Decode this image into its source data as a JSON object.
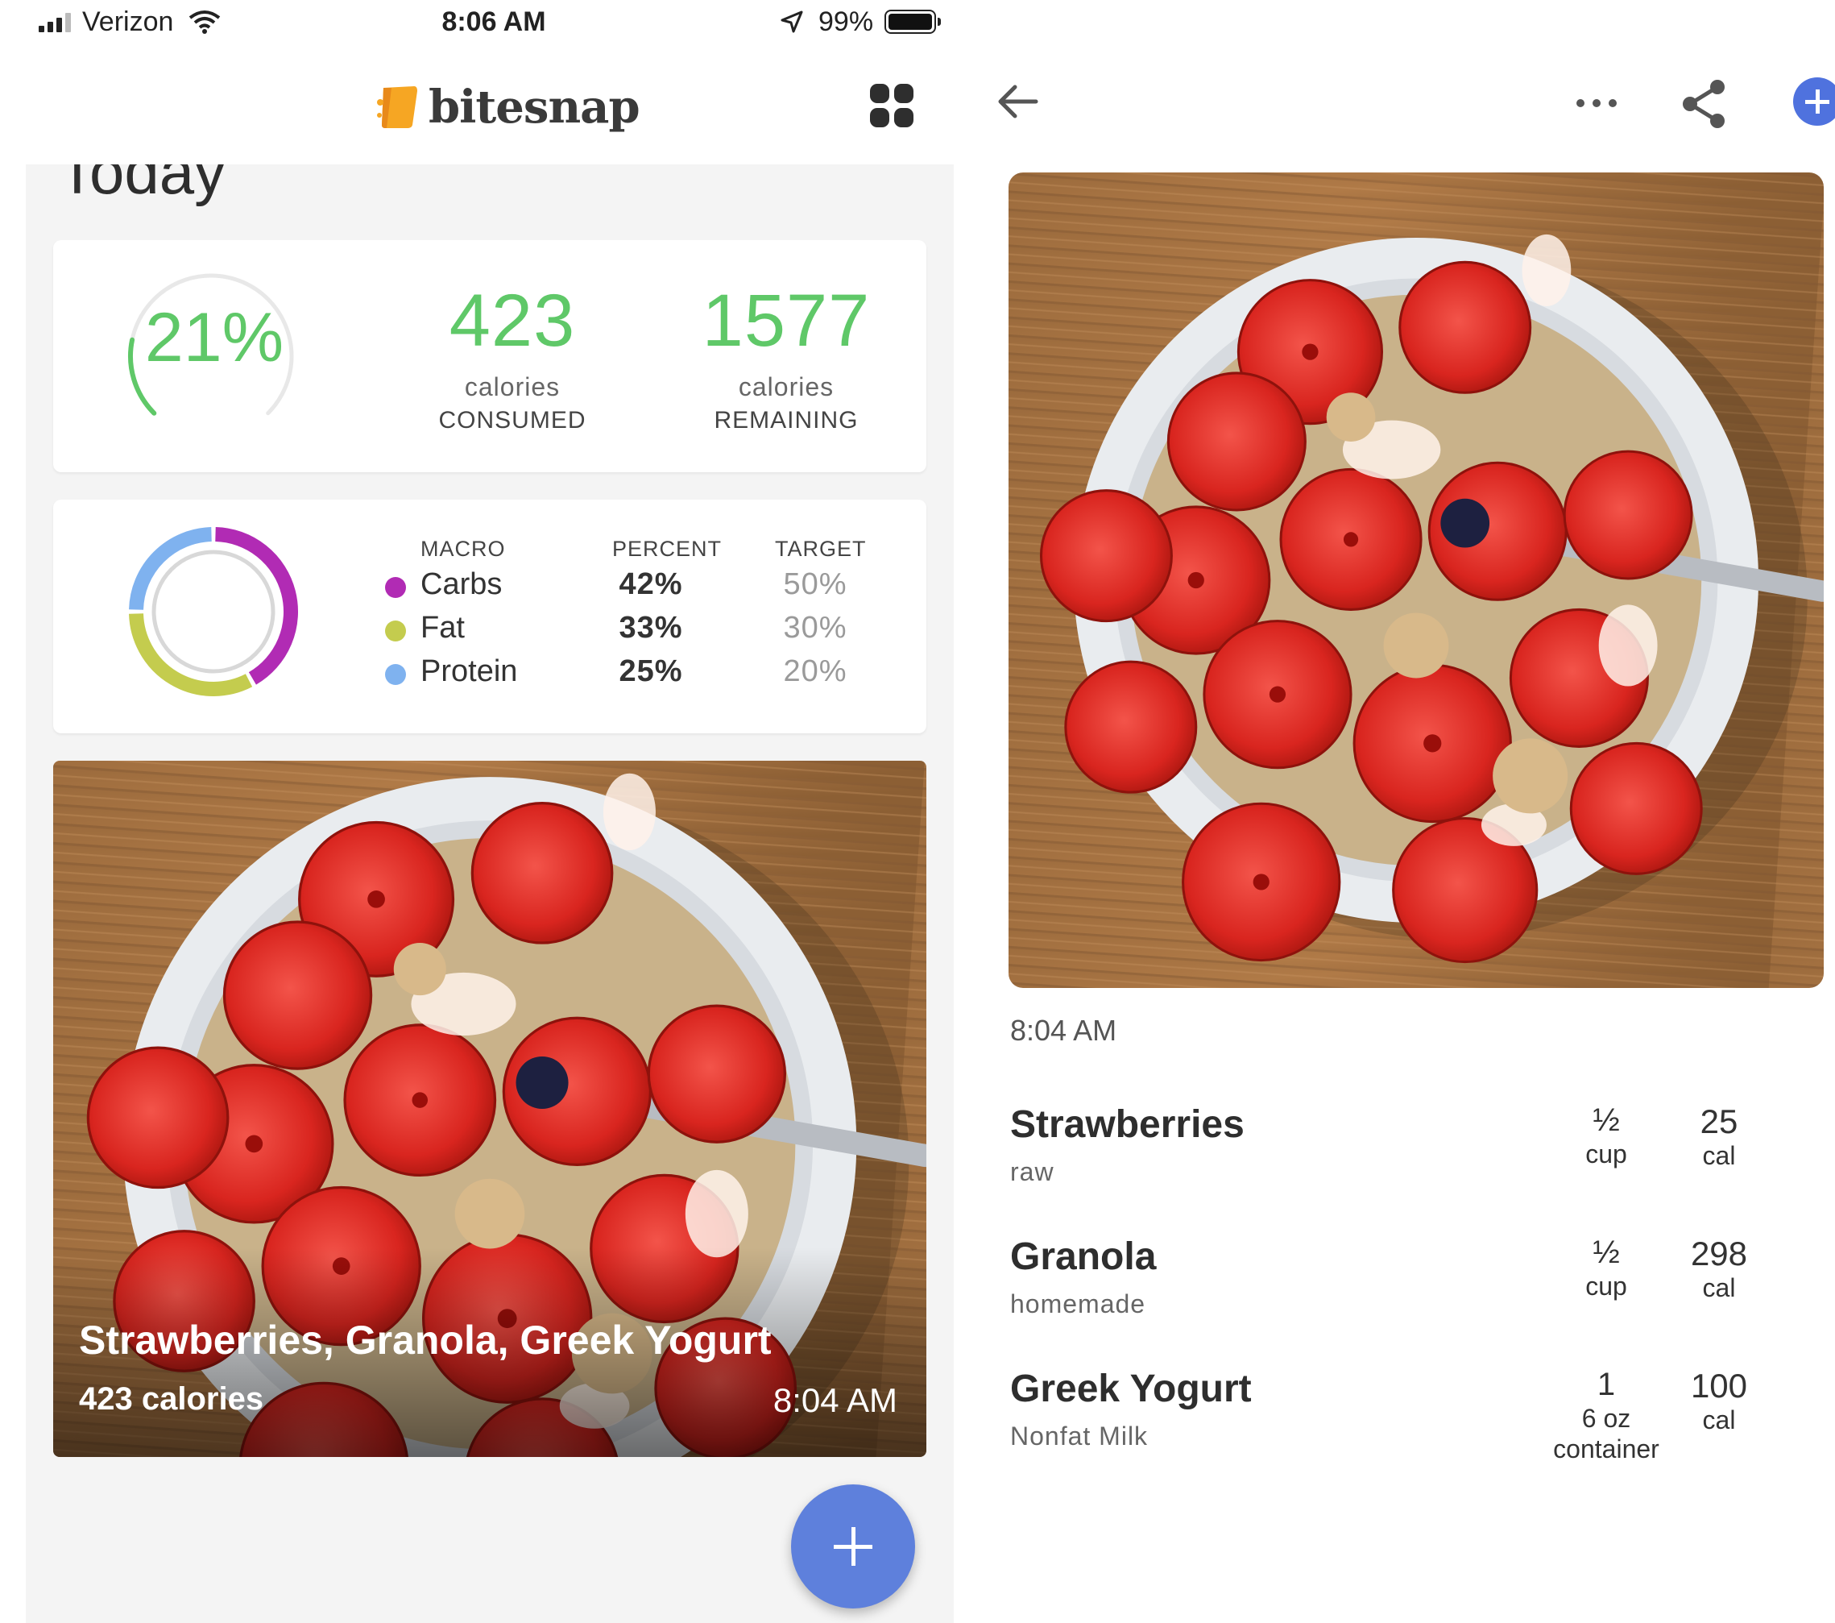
{
  "status_bar": {
    "carrier": "Verizon",
    "time": "8:06 AM",
    "battery": "99%"
  },
  "app": {
    "name": "bitesnap",
    "section_title": "Today"
  },
  "calories": {
    "percent_label": "21%",
    "percent": 0.21,
    "consumed_value": "423",
    "consumed_sub": "calories",
    "consumed_label": "CONSUMED",
    "remaining_value": "1577",
    "remaining_sub": "calories",
    "remaining_label": "REMAINING"
  },
  "macros": {
    "headers": {
      "macro": "MACRO",
      "percent": "PERCENT",
      "target": "TARGET"
    },
    "rows": [
      {
        "name": "Carbs",
        "percent": "42%",
        "target": "50%",
        "value": 42,
        "color": "#b12bb4"
      },
      {
        "name": "Fat",
        "percent": "33%",
        "target": "30%",
        "value": 33,
        "color": "#c4cc4e"
      },
      {
        "name": "Protein",
        "percent": "25%",
        "target": "20%",
        "value": 25,
        "color": "#7fb2ef"
      }
    ]
  },
  "meal": {
    "title": "Strawberries, Granola, Greek Yogurt",
    "calories": "423 calories",
    "time": "8:04 AM"
  },
  "detail": {
    "time": "8:04 AM",
    "items": [
      {
        "name": "Strawberries",
        "desc": "raw",
        "qty": "½",
        "unit": "cup",
        "unit2": "",
        "cal": "25",
        "cal_unit": "cal"
      },
      {
        "name": "Granola",
        "desc": "homemade",
        "qty": "½",
        "unit": "cup",
        "unit2": "",
        "cal": "298",
        "cal_unit": "cal"
      },
      {
        "name": "Greek Yogurt",
        "desc": "Nonfat Milk",
        "qty": "1",
        "unit": "6 oz",
        "unit2": "container",
        "cal": "100",
        "cal_unit": "cal"
      }
    ]
  },
  "colors": {
    "accent_green": "#5fc868",
    "fab_blue": "#5e80dc",
    "header_plus_blue": "#4f72de"
  },
  "icons": [
    "signal-icon",
    "wifi-icon",
    "location-icon",
    "battery-icon",
    "bitesnap-logo-icon",
    "grid-icon",
    "back-arrow-icon",
    "more-icon",
    "share-icon",
    "add-icon"
  ]
}
